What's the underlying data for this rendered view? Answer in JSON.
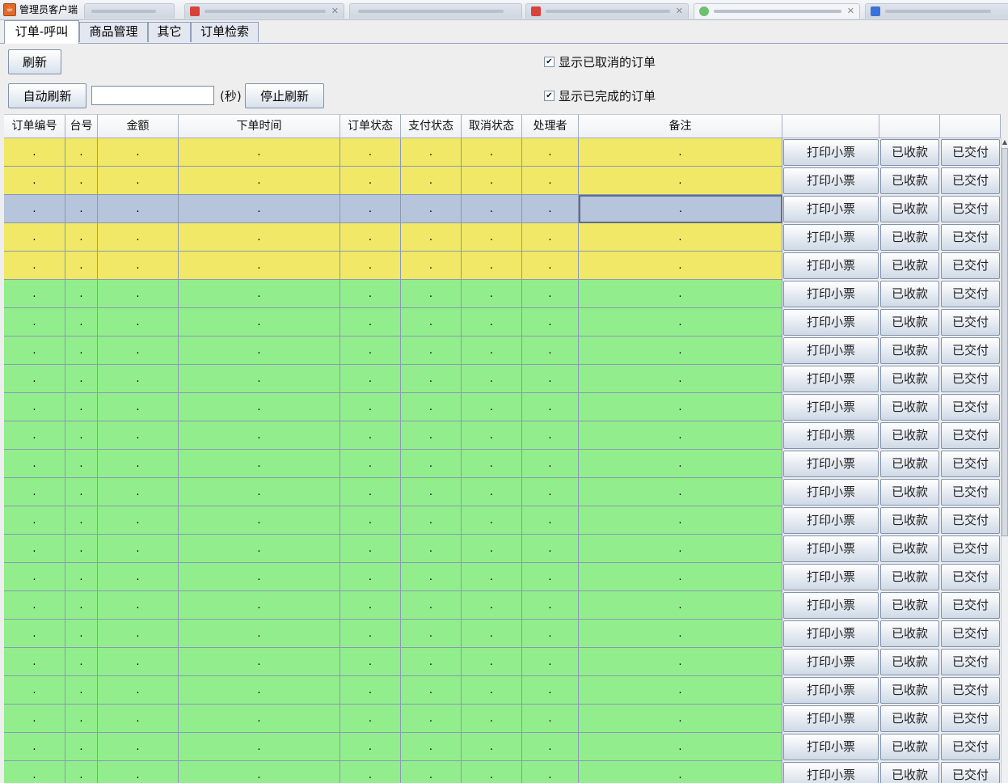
{
  "window": {
    "title": "管理员客户端"
  },
  "tabs": [
    {
      "label": "订单-呼叫",
      "active": true
    },
    {
      "label": "商品管理",
      "active": false
    },
    {
      "label": "其它",
      "active": false
    },
    {
      "label": "订单检索",
      "active": false
    }
  ],
  "controls": {
    "refresh_label": "刷新",
    "auto_refresh_label": "自动刷新",
    "interval_value": "",
    "seconds_label": "(秒)",
    "stop_refresh_label": "停止刷新",
    "show_cancelled_label": "显示已取消的订单",
    "show_cancelled_checked": true,
    "show_completed_label": "显示已完成的订单",
    "show_completed_checked": true
  },
  "table": {
    "columns": [
      "订单编号",
      "台号",
      "金额",
      "下单时间",
      "订单状态",
      "支付状态",
      "取消状态",
      "处理者",
      "备注",
      "",
      "",
      ""
    ],
    "button_labels": [
      "打印小票",
      "已收款",
      "已交付"
    ],
    "cell_placeholder": ".",
    "row_colors": {
      "yellow": "#f0e866",
      "selected": "#b6c4dc",
      "green": "#92ee8c"
    },
    "rows": [
      {
        "color": "yellow"
      },
      {
        "color": "yellow"
      },
      {
        "color": "selected",
        "focus_col": 8
      },
      {
        "color": "yellow"
      },
      {
        "color": "yellow"
      },
      {
        "color": "green"
      },
      {
        "color": "green"
      },
      {
        "color": "green"
      },
      {
        "color": "green"
      },
      {
        "color": "green"
      },
      {
        "color": "green"
      },
      {
        "color": "green"
      },
      {
        "color": "green"
      },
      {
        "color": "green"
      },
      {
        "color": "green"
      },
      {
        "color": "green"
      },
      {
        "color": "green"
      },
      {
        "color": "green"
      },
      {
        "color": "green"
      },
      {
        "color": "green"
      },
      {
        "color": "green"
      },
      {
        "color": "green"
      },
      {
        "color": "green"
      }
    ]
  }
}
